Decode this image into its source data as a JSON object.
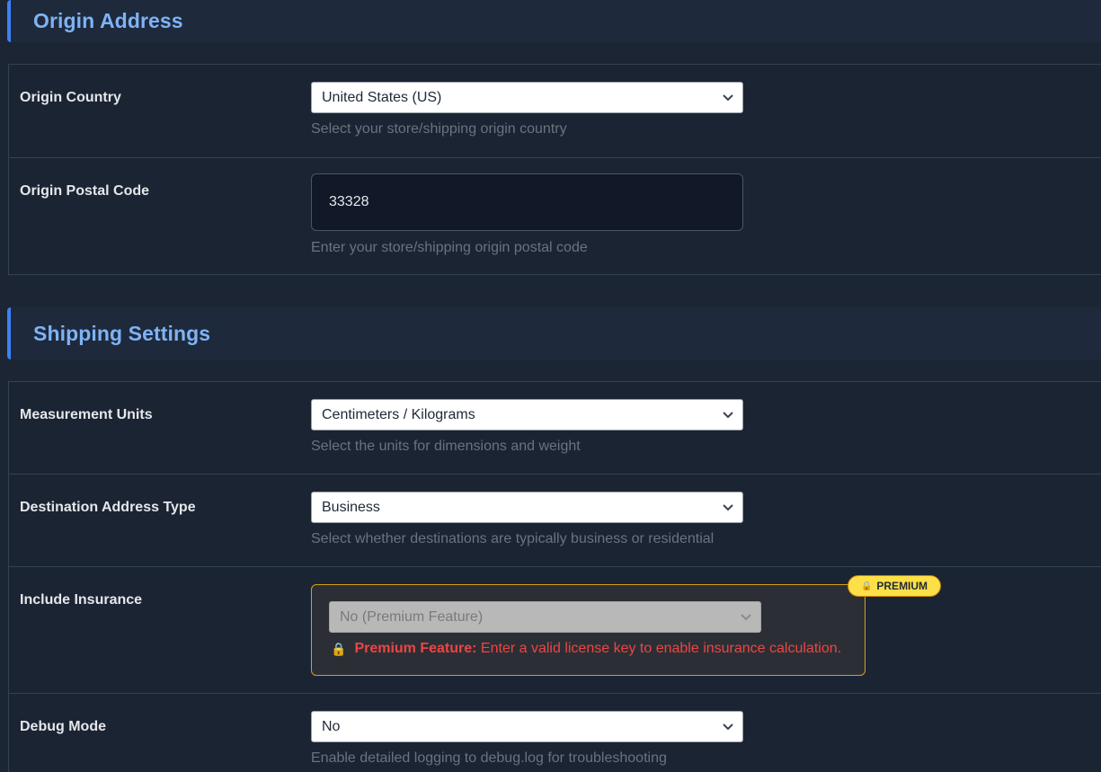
{
  "origin": {
    "title": "Origin Address",
    "country": {
      "label": "Origin Country",
      "value": "United States (US)",
      "help": "Select your store/shipping origin country"
    },
    "postal": {
      "label": "Origin Postal Code",
      "value": "33328",
      "help": "Enter your store/shipping origin postal code"
    }
  },
  "shipping": {
    "title": "Shipping Settings",
    "units": {
      "label": "Measurement Units",
      "value": "Centimeters / Kilograms",
      "help": "Select the units for dimensions and weight"
    },
    "address_type": {
      "label": "Destination Address Type",
      "value": "Business",
      "help": "Select whether destinations are typically business or residential"
    },
    "insurance": {
      "label": "Include Insurance",
      "value": "No (Premium Feature)",
      "badge": "PREMIUM",
      "note_bold": "Premium Feature:",
      "note_text": " Enter a valid license key to enable insurance calculation.",
      "lock_icon": "lock-icon"
    },
    "debug": {
      "label": "Debug Mode",
      "value": "No",
      "help": "Enable detailed logging to debug.log for troubleshooting"
    }
  },
  "colors": {
    "accent": "#3b82f6",
    "heading": "#7eb3f5",
    "premium_border": "#d4a017",
    "premium_badge": "#fde047",
    "error": "#ef4444"
  }
}
